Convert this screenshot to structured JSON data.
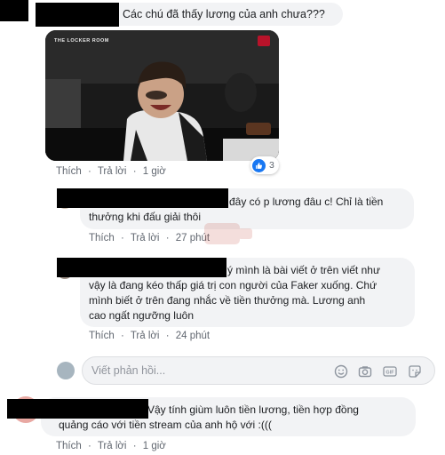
{
  "comments": [
    {
      "text": "Các chú đã thấy lương của anh chưa???",
      "actions": {
        "like": "Thích",
        "reply": "Trả lời",
        "time": "1 giờ"
      },
      "video": {
        "title": "THE LOCKER ROOM"
      },
      "reaction_count": "3"
    },
    {
      "text_line1": "đây có p lương đâu c! Chỉ là tiền",
      "text_line2": "thưởng khi đấu giải thôi",
      "actions": {
        "like": "Thích",
        "reply": "Trả lời",
        "time": "27 phút"
      }
    },
    {
      "text_line1": "ý mình là bài viết ở trên viết như",
      "text_line2": "vậy là đang kéo thấp giá trị con người của Faker xuống. Chứ",
      "text_line3": "mình biết ở trên đang nhắc về tiền thưởng mà. Lương anh",
      "text_line4": "cao ngất ngưỡng luôn",
      "actions": {
        "like": "Thích",
        "reply": "Trả lời",
        "time": "24 phút"
      }
    },
    {
      "text_line1": "Vậy tính giùm luôn tiền lương, tiền hợp đồng",
      "text_line2": "quảng cáo với tiền stream của anh hộ với :(((",
      "actions": {
        "like": "Thích",
        "reply": "Trả lời",
        "time": "1 giờ"
      }
    }
  ],
  "reply_box": {
    "placeholder": "Viết phản hồi..."
  },
  "separator": "·",
  "colors": {
    "like_blue": "#1877f2",
    "bubble": "#f2f3f5",
    "meta_text": "#616770"
  },
  "icons": [
    "like-icon",
    "emoji-icon",
    "camera-icon",
    "gif-icon",
    "sticker-icon"
  ]
}
